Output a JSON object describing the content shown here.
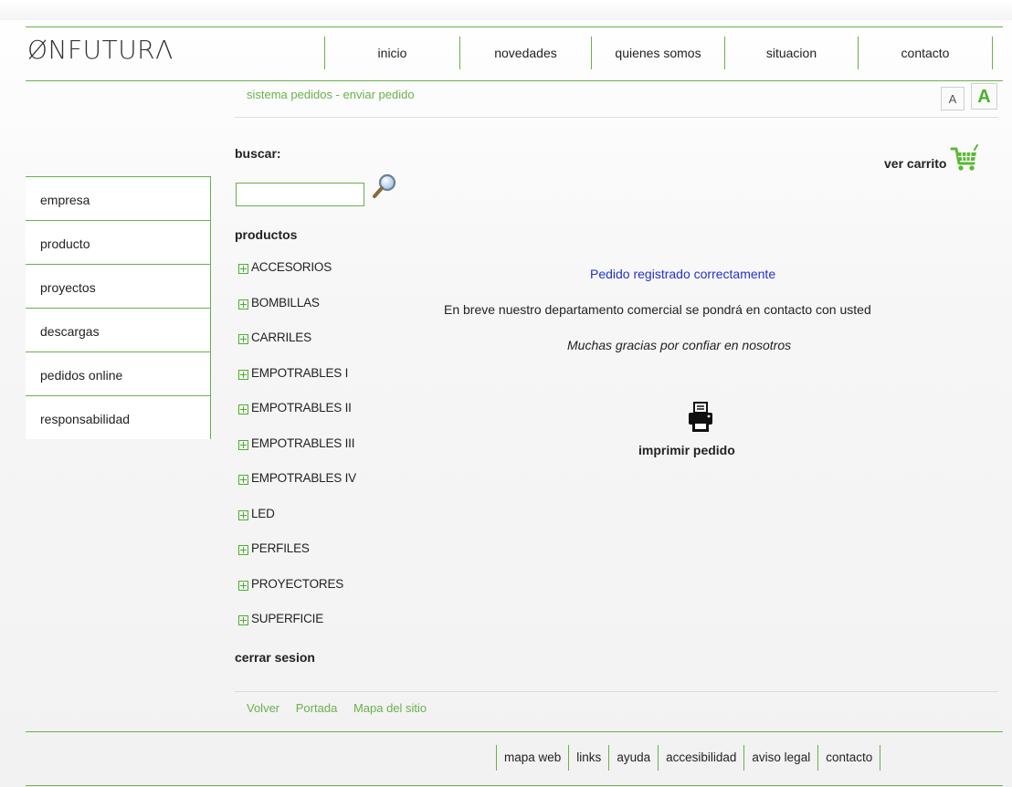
{
  "header": {
    "logo": "ØNFUTURΛ",
    "nav": [
      {
        "label": "inicio"
      },
      {
        "label": "novedades"
      },
      {
        "label": "quienes somos"
      },
      {
        "label": "situacion"
      },
      {
        "label": "contacto"
      }
    ],
    "breadcrumb": "sistema pedidos - enviar pedido",
    "font_small_label": "A",
    "font_large_label": "A"
  },
  "sidebar": {
    "items": [
      {
        "label": "empresa"
      },
      {
        "label": "producto"
      },
      {
        "label": "proyectos"
      },
      {
        "label": "descargas"
      },
      {
        "label": "pedidos online"
      },
      {
        "label": "responsabilidad"
      }
    ]
  },
  "search": {
    "heading": "buscar:",
    "value": "",
    "placeholder": ""
  },
  "products": {
    "heading": "productos",
    "items": [
      {
        "label": "ACCESORIOS"
      },
      {
        "label": "BOMBILLAS"
      },
      {
        "label": "CARRILES"
      },
      {
        "label": "EMPOTRABLES I"
      },
      {
        "label": "EMPOTRABLES II"
      },
      {
        "label": "EMPOTRABLES III"
      },
      {
        "label": "EMPOTRABLES IV"
      },
      {
        "label": "LED"
      },
      {
        "label": "PERFILES"
      },
      {
        "label": "PROYECTORES"
      },
      {
        "label": "SUPERFICIE"
      }
    ],
    "logout": "cerrar sesion"
  },
  "cart": {
    "label": "ver carrito"
  },
  "main": {
    "success_message": "Pedido registrado correctamente",
    "contact_message": "En breve nuestro departamento comercial se pondrá en contacto con usted",
    "thanks_message": "Muchas gracias por confiar en nosotros",
    "print_label": "imprimir pedido"
  },
  "bottom_links": [
    {
      "label": "Volver"
    },
    {
      "label": "Portada"
    },
    {
      "label": "Mapa del sitio"
    }
  ],
  "footer": {
    "nav": [
      {
        "label": "mapa web"
      },
      {
        "label": "links"
      },
      {
        "label": "ayuda"
      },
      {
        "label": "accesibilidad"
      },
      {
        "label": "aviso legal"
      },
      {
        "label": "contacto"
      }
    ]
  },
  "colors": {
    "accent": "#6ab04c",
    "link_blue": "#2233cc"
  }
}
